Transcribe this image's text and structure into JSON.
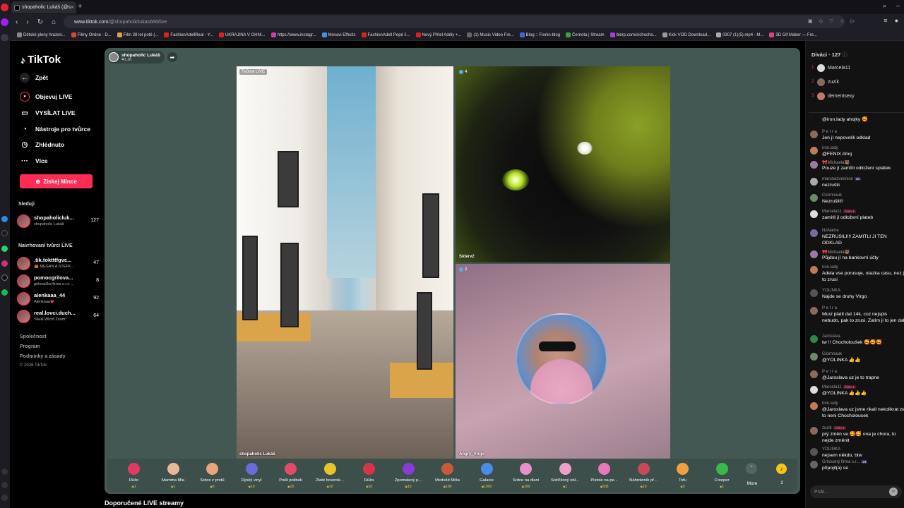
{
  "browser": {
    "tab_title": "shopaholic Lukáš (@s",
    "url_domain": "www.tiktok.com",
    "url_path": "/@shopaholiclukas666/live",
    "bookmarks": [
      "Dětské pleny hrazen...",
      "Filmy Online - D...",
      "Film 28 let poté (...",
      "FashionAdellReal - Y...",
      "UKRAJINA V OHNI...",
      "https://www.instagr...",
      "Movavi Effects",
      "FashionAdell Pepé č...",
      "Nový Přítel Adély +...",
      "(1) Music Video Fre...",
      "Blog :: Fionin-blog",
      "Černota | Stream",
      "blerp.com/s/chocho...",
      "Kick VOD Download...",
      "0307 (1)(5).mp4 - M...",
      "3D Gif Maker — Fre..."
    ]
  },
  "sidebar": {
    "logo": "TikTok",
    "back": "Zpět",
    "menu": [
      "Objevuj LIVE",
      "VYSÍLAT LIVE",
      "Nástroje pro tvůrce",
      "Zhlédnuto",
      "Více"
    ],
    "coins_button": "Získej Mince",
    "following_title": "Sleduji",
    "following": [
      {
        "name": "shopaholicluk...",
        "sub": "shopaholic Lukáš",
        "count": "127"
      }
    ],
    "suggested_title": "Navrhovaní tvůrci LIVE",
    "suggested": [
      {
        "name": ".tik.toktttfgvc...",
        "sub": "🦊 MEGAN A ŠTEFK...",
        "count": "47"
      },
      {
        "name": "pomocgrilova...",
        "sub": "grilovačka firma s.r.o ...",
        "count": "8"
      },
      {
        "name": "alenkaaa_44",
        "sub": "Alenkaaa💗",
        "count": "92"
      },
      {
        "name": "real.lovci.duch...",
        "sub": "°Real Wlcnf Zoom°",
        "count": "64"
      }
    ],
    "footer": [
      "Společnost",
      "Program",
      "Podmínky a zásady",
      "© 2026 TikTok"
    ]
  },
  "stream": {
    "host_name": "shopaholic Lukáš",
    "host_likes": "❤1.3K",
    "creator_badge": "Tvůrce LIVE",
    "cell1_name": "shopaholic Lukáš",
    "cell2_viewers": "4",
    "cell2_name": "Siderv2",
    "cell3_viewers": "2",
    "cell3_name": "Angry_Virgo"
  },
  "gifts": [
    {
      "name": "Růže",
      "price": "1",
      "color": "#e23a64"
    },
    {
      "name": "Mamma Mia",
      "price": "1",
      "color": "#e6b89a"
    },
    {
      "name": "Srdce z prstů",
      "price": "5",
      "color": "#e8a47a"
    },
    {
      "name": "Dýský vinyl",
      "price": "10",
      "color": "#6a6ad8"
    },
    {
      "name": "Pošli polibek",
      "price": "10",
      "color": "#e24a6a"
    },
    {
      "name": "Zlaté boxersk...",
      "price": "10",
      "color": "#e8c42a"
    },
    {
      "name": "Růža",
      "price": "10",
      "color": "#d8334a"
    },
    {
      "name": "Zpomalený p...",
      "price": "10",
      "color": "#8a3ad8"
    },
    {
      "name": "Medvěd Míša",
      "price": "100",
      "color": "#c85a3a"
    },
    {
      "name": "Galaxie",
      "price": "1000",
      "color": "#4a8ae8"
    },
    {
      "name": "Srdce na dlani",
      "price": "100",
      "color": "#e890c8"
    },
    {
      "name": "Srdíčkový obl...",
      "price": "1",
      "color": "#f0a0c8"
    },
    {
      "name": "Pistole na pe...",
      "price": "500",
      "color": "#e878b8"
    },
    {
      "name": "Náhrdelník př...",
      "price": "10",
      "color": "#c84a5a"
    },
    {
      "name": "Tofu",
      "price": "5",
      "color": "#f0a040"
    },
    {
      "name": "Creeper",
      "price": "1",
      "color": "#3ab84a"
    }
  ],
  "gift_more": "Více",
  "gift_more2": "More",
  "coin_count": "2",
  "recommended": "Doporučené LIVE streamy",
  "viewers_panel": {
    "title": "Diváci",
    "count": "127",
    "list": [
      {
        "rank": "1",
        "name": "Marcela11"
      },
      {
        "rank": "2",
        "name": "zuzik"
      },
      {
        "rank": "3",
        "name": "dementsexy"
      }
    ]
  },
  "chat": [
    {
      "user": "",
      "text": "@iron.lady ahojky 🥰"
    },
    {
      "user": "P e t r a",
      "text": "Jen jí nepovolili odklad"
    },
    {
      "user": "iron.lady",
      "text": "@FENIX Ahoj"
    },
    {
      "user": "🎀Michaela🐻",
      "text": "Pouze jí zamítli odložení splátek"
    },
    {
      "user": "marunazvesnice",
      "tag": "16",
      "text": "nezrušili"
    },
    {
      "user": "Cicimnauk",
      "text": "Nezrušili!!"
    },
    {
      "user": "Marcela11",
      "tag": "Číslo 1",
      "text": "zamitli ji odložení plateb"
    },
    {
      "user": "NoName",
      "text": "NEZRUSILI!!! ZAMITLI JI TEN ODKLAD"
    },
    {
      "user": "🎀Michaela🐻",
      "text": "Půjdou jí na bankovní účty"
    },
    {
      "user": "iron.lady",
      "text": "Adela vse porusuje, otazka casu, nez ji to zrusi"
    },
    {
      "user": "YOLINKA",
      "text": "Najde se druhy Virgo"
    },
    {
      "user": "P e t r a",
      "text": "Musí platit dal 14k, coz nejspis nebudo, pak to zrusi. Zatim ji to jen dal"
    },
    {
      "user": "Jaroslava",
      "text": "tw !! Chocholoušek 🥰🥰🥰"
    },
    {
      "user": "Cicimnauk",
      "text": "@YOLINKA 👍👍"
    },
    {
      "user": "P e t r a",
      "text": "@Jaroslava uz je to trapne"
    },
    {
      "user": "Marcela11",
      "tag": "Číslo 1",
      "text": "@YOLINKA 👍👍👍"
    },
    {
      "user": "iron.lady",
      "text": "@Jaroslava uz jsme rikali nekolikrat ze to neni Chocholousek"
    },
    {
      "user": "zuzik",
      "tag": "Číslo 2",
      "text": "prý změn se 🥰🥰 ona je chora, to nejde změnit"
    },
    {
      "user": "YOLINKA",
      "text": "nejsem někdo, btw"
    },
    {
      "user": "Grilovaný firma s.r...",
      "tag": "23",
      "text": "připojil(a) se"
    }
  ],
  "chat_input_placeholder": "Psát..."
}
